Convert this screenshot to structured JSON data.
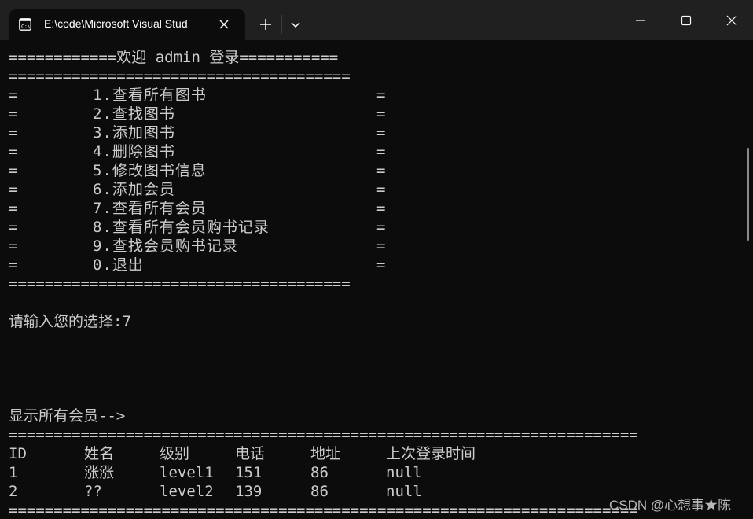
{
  "window": {
    "tab_title": "E:\\code\\Microsoft Visual Stud",
    "new_tab_label": "+",
    "accent": "#0c0c0c",
    "titlebar_color": "#202020",
    "text_color": "#cccccc"
  },
  "console": {
    "welcome_line": "============欢迎 admin 登录===========",
    "rule_short": "======================================",
    "menu_border": "=",
    "menu": [
      "1.查看所有图书",
      "2.查找图书",
      "3.添加图书",
      "4.删除图书",
      "5.修改图书信息",
      "6.添加会员",
      "7.查看所有会员",
      "8.查看所有会员购书记录",
      "9.查找会员购书记录",
      "0.退出"
    ],
    "prompt": "请输入您的选择:7",
    "list_header": "显示所有会员-->",
    "rule_long": "======================================================================",
    "table": {
      "columns": [
        "ID",
        "姓名",
        "级别",
        "电话",
        "地址",
        "上次登录时间"
      ],
      "rows": [
        [
          "1",
          "涨涨",
          "level1",
          "151",
          "86",
          "null"
        ],
        [
          "2",
          "??",
          "level2",
          "139",
          "86",
          "null"
        ]
      ]
    }
  },
  "watermark": "CSDN @心想事★陈"
}
